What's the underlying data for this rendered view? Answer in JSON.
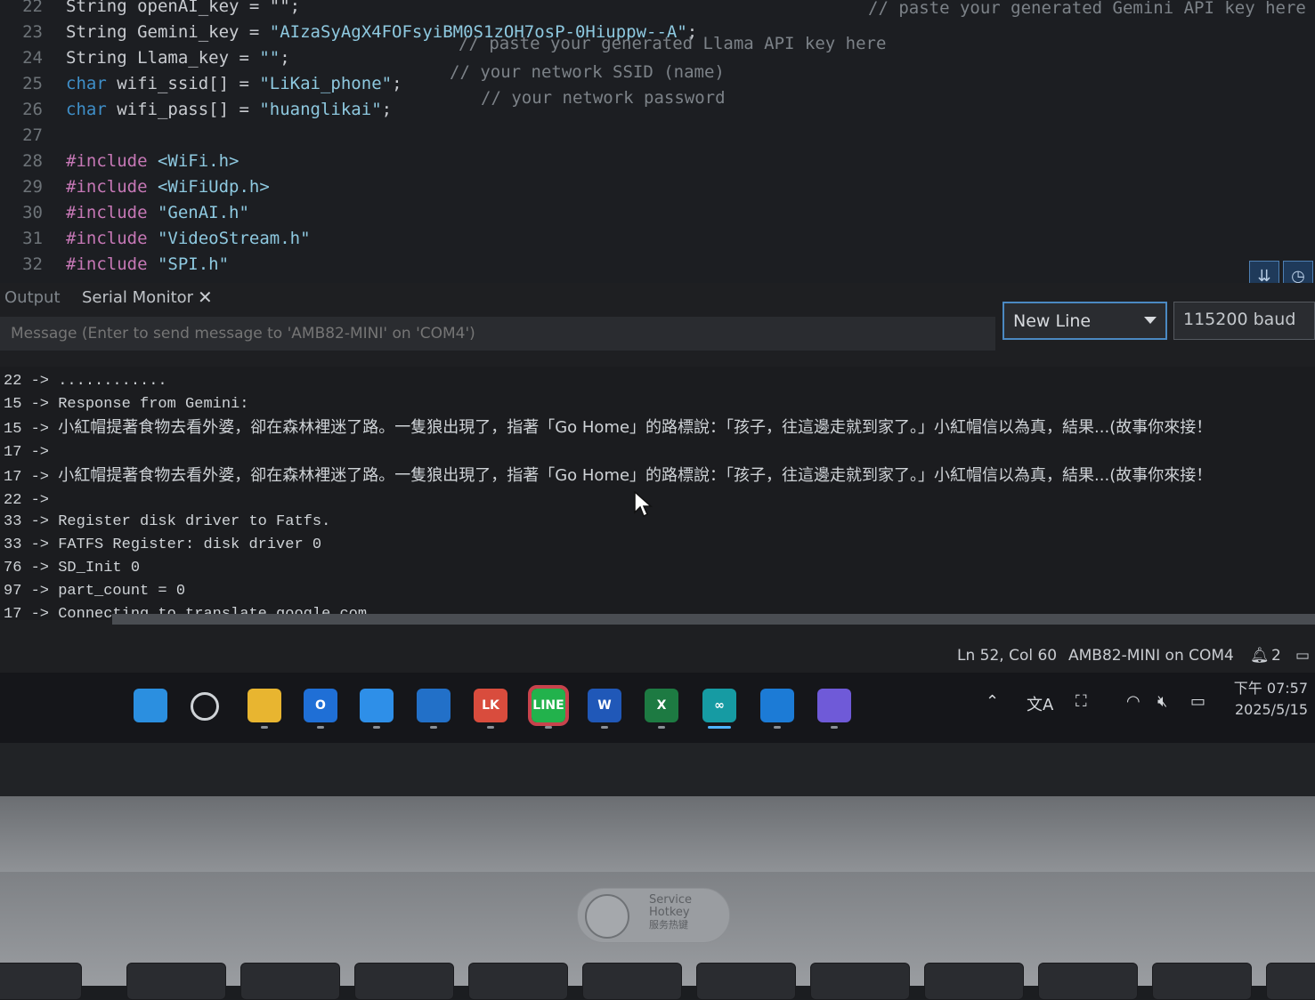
{
  "editor": {
    "lines": [
      {
        "num": "22",
        "segments": [
          {
            "t": "String openAI_key = \"\";",
            "c": "plain"
          }
        ]
      },
      {
        "num": "23",
        "segments": [
          {
            "t": "String Gemini_key = ",
            "c": "plain"
          },
          {
            "t": "\"AIzaSyAgX4FOFsyiBM0S1zOH7osP-0Hiuppw--A\"",
            "c": "str"
          },
          {
            "t": ";",
            "c": "plain"
          }
        ]
      },
      {
        "num": "24",
        "segments": [
          {
            "t": "String Llama_key = ",
            "c": "plain"
          },
          {
            "t": "\"\"",
            "c": "str"
          },
          {
            "t": ";",
            "c": "plain"
          }
        ]
      },
      {
        "num": "25",
        "segments": [
          {
            "t": "char",
            "c": "kw"
          },
          {
            "t": " wifi_ssid[] = ",
            "c": "plain"
          },
          {
            "t": "\"LiKai_phone\"",
            "c": "str"
          },
          {
            "t": ";",
            "c": "plain"
          }
        ]
      },
      {
        "num": "26",
        "segments": [
          {
            "t": "char",
            "c": "kw"
          },
          {
            "t": " wifi_pass[] = ",
            "c": "plain"
          },
          {
            "t": "\"huanglikai\"",
            "c": "str"
          },
          {
            "t": ";",
            "c": "plain"
          }
        ]
      },
      {
        "num": "27",
        "segments": []
      },
      {
        "num": "28",
        "segments": [
          {
            "t": "#include",
            "c": "pp"
          },
          {
            "t": " <WiFi.h>",
            "c": "str"
          }
        ]
      },
      {
        "num": "29",
        "segments": [
          {
            "t": "#include",
            "c": "pp"
          },
          {
            "t": " <WiFiUdp.h>",
            "c": "str"
          }
        ]
      },
      {
        "num": "30",
        "segments": [
          {
            "t": "#include",
            "c": "pp"
          },
          {
            "t": " \"GenAI.h\"",
            "c": "str"
          }
        ]
      },
      {
        "num": "31",
        "segments": [
          {
            "t": "#include",
            "c": "pp"
          },
          {
            "t": " \"VideoStream.h\"",
            "c": "str"
          }
        ]
      },
      {
        "num": "32",
        "segments": [
          {
            "t": "#include",
            "c": "pp"
          },
          {
            "t": " \"SPI.h\"",
            "c": "str"
          }
        ]
      }
    ],
    "comments": [
      "// paste your generated Gemini API key here",
      "// paste your generated Llama API key here",
      "// your network SSID (name)",
      "// your network password"
    ]
  },
  "panel": {
    "tabs": [
      "Output",
      "Serial Monitor"
    ],
    "close_glyph": "✕",
    "message_placeholder": "Message (Enter to send message to 'AMB82-MINI' on 'COM4')",
    "line_ending": "New Line",
    "baud": "115200 baud",
    "serial_lines": [
      {
        "prefix": "22 -> ",
        "text": "............"
      },
      {
        "prefix": "15 -> ",
        "text": "Response from Gemini:"
      },
      {
        "prefix": "15 -> ",
        "text": "小紅帽提著食物去看外婆，卻在森林裡迷了路。一隻狼出現了，指著「Go Home」的路標說：「孩子，往這邊走就到家了。」小紅帽信以為真，結果...(故事你來接！"
      },
      {
        "prefix": "17 -> ",
        "text": ""
      },
      {
        "prefix": "17 -> ",
        "text": "小紅帽提著食物去看外婆，卻在森林裡迷了路。一隻狼出現了，指著「Go Home」的路標說：「孩子，往這邊走就到家了。」小紅帽信以為真，結果...(故事你來接！"
      },
      {
        "prefix": "22 -> ",
        "text": ""
      },
      {
        "prefix": "33 -> ",
        "text": "Register disk driver to Fatfs."
      },
      {
        "prefix": "33 -> ",
        "text": "FATFS Register: disk driver 0"
      },
      {
        "prefix": "76 -> ",
        "text": "SD_Init 0"
      },
      {
        "prefix": "97 -> ",
        "text": "part_count = 0"
      },
      {
        "prefix": "17 -> ",
        "text": "Connecting to translate.google.com"
      }
    ]
  },
  "statusbar": {
    "position": "Ln 52, Col 60",
    "board": "AMB82-MINI on COM4",
    "notifications": "2"
  },
  "taskbar": {
    "icons": [
      {
        "name": "windows-start",
        "label": "",
        "color": "#2b8fe0"
      },
      {
        "name": "search",
        "label": "",
        "color": "#3a3c40"
      },
      {
        "name": "file-explorer",
        "label": "",
        "color": "#e8b530"
      },
      {
        "name": "outlook",
        "label": "O",
        "color": "#1f6fd6"
      },
      {
        "name": "sync-app",
        "label": "",
        "color": "#2e8fe8"
      },
      {
        "name": "photos",
        "label": "",
        "color": "#2270c8"
      },
      {
        "name": "chrome",
        "label": "LK",
        "color": "#d94c3d"
      },
      {
        "name": "line",
        "label": "LINE",
        "color": "#22b24c"
      },
      {
        "name": "word",
        "label": "W",
        "color": "#2058b8"
      },
      {
        "name": "excel",
        "label": "X",
        "color": "#1d7a42"
      },
      {
        "name": "arduino-ide",
        "label": "∞",
        "color": "#169ba3"
      },
      {
        "name": "edge",
        "label": "",
        "color": "#1c7bd6"
      },
      {
        "name": "zoom-lens",
        "label": "",
        "color": "#6f5ad8"
      }
    ],
    "clock_time": "下午 07:57",
    "clock_date": "2025/5/15"
  },
  "hardware": {
    "service_label_1": "Service",
    "service_label_2": "Hotkey",
    "service_label_3": "服务热键"
  }
}
